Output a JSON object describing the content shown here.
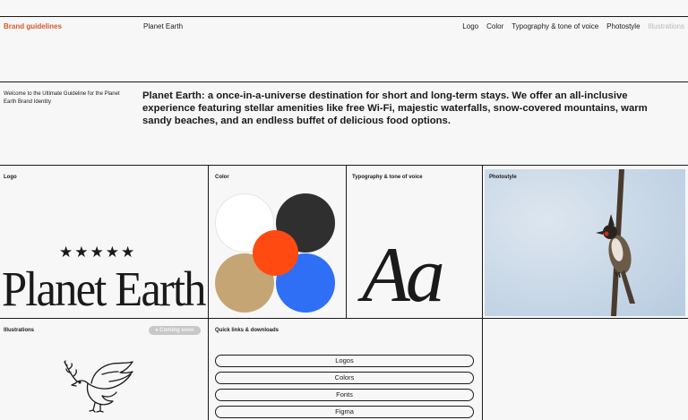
{
  "header": {
    "brand": "Brand guidelines",
    "site_name": "Planet Earth",
    "nav": [
      "Logo",
      "Color",
      "Typography & tone of voice",
      "Photostyle"
    ],
    "nav_disabled": "Illustrations"
  },
  "intro": {
    "welcome": "Welcome to the Ultimate Guideline for the Planet Earth Brand Identity",
    "text": "Planet Earth: a once-in-a-universe destination for short and long-term stays. We offer an all-inclusive experience featuring stellar amenities like free Wi-Fi, majestic waterfalls, snow-covered mountains, warm sandy beaches, and an endless buffet of delicious food options."
  },
  "cells": {
    "logo": {
      "label": "Logo",
      "stars": "★★★★★",
      "wordmark": "Planet Earth"
    },
    "color": {
      "label": "Color",
      "swatches": [
        "#ffffff",
        "#2f2f2f",
        "#ff4b12",
        "#c6a574",
        "#2f6ff5"
      ]
    },
    "typography": {
      "label": "Typography & tone of voice",
      "sample": "Aa"
    },
    "photostyle": {
      "label": "Photostyle"
    },
    "illustrations": {
      "label": "Illustrations",
      "badge": "● Coming soon"
    },
    "quick_links": {
      "label": "Quick links & downloads",
      "links": [
        "Logos",
        "Colors",
        "Fonts",
        "Figma"
      ]
    }
  },
  "colors": {
    "accent": "#d4582c",
    "line": "#1a1a1a",
    "disabled": "#b9b9b9"
  }
}
